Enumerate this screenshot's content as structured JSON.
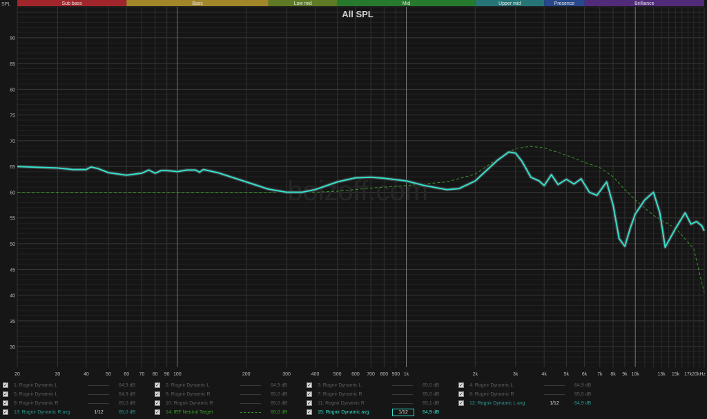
{
  "chart_data": {
    "type": "line",
    "title": "All SPL",
    "ylabel": "SPL",
    "xlabel": "",
    "x_scale": "log",
    "xlim": [
      20,
      20000
    ],
    "ylim": [
      26,
      96
    ],
    "x_ticks": [
      {
        "v": 20,
        "label": "20"
      },
      {
        "v": 30,
        "label": "30"
      },
      {
        "v": 40,
        "label": "40"
      },
      {
        "v": 50,
        "label": "50"
      },
      {
        "v": 60,
        "label": "60"
      },
      {
        "v": 70,
        "label": "70"
      },
      {
        "v": 80,
        "label": "80"
      },
      {
        "v": 90,
        "label": "90"
      },
      {
        "v": 100,
        "label": "100"
      },
      {
        "v": 200,
        "label": "200"
      },
      {
        "v": 300,
        "label": "300"
      },
      {
        "v": 400,
        "label": "400"
      },
      {
        "v": 500,
        "label": "500"
      },
      {
        "v": 600,
        "label": "600"
      },
      {
        "v": 700,
        "label": "700"
      },
      {
        "v": 800,
        "label": "800"
      },
      {
        "v": 900,
        "label": "900"
      },
      {
        "v": 1000,
        "label": "1k"
      },
      {
        "v": 2000,
        "label": "2k"
      },
      {
        "v": 3000,
        "label": "3k"
      },
      {
        "v": 4000,
        "label": "4k"
      },
      {
        "v": 5000,
        "label": "5k"
      },
      {
        "v": 6000,
        "label": "6k"
      },
      {
        "v": 7000,
        "label": "7k"
      },
      {
        "v": 8000,
        "label": "8k"
      },
      {
        "v": 9000,
        "label": "9k"
      },
      {
        "v": 10000,
        "label": "10k"
      },
      {
        "v": 13000,
        "label": "13k"
      },
      {
        "v": 15000,
        "label": "15k"
      },
      {
        "v": 17000,
        "label": "17k"
      },
      {
        "v": 20000,
        "label": "20kHz"
      }
    ],
    "y_ticks": [
      30,
      35,
      40,
      45,
      50,
      55,
      60,
      65,
      70,
      75,
      80,
      85,
      90
    ],
    "bands": [
      {
        "label": "Sub bass",
        "from": 20,
        "to": 60,
        "color": "#a1262c"
      },
      {
        "label": "Bass",
        "from": 60,
        "to": 250,
        "color": "#a2862a"
      },
      {
        "label": "Low mid",
        "from": 250,
        "to": 500,
        "color": "#5f7a25"
      },
      {
        "label": "Mid",
        "from": 500,
        "to": 2000,
        "color": "#27792e"
      },
      {
        "label": "Upper mid",
        "from": 2000,
        "to": 4000,
        "color": "#267475"
      },
      {
        "label": "Presence",
        "from": 4000,
        "to": 6000,
        "color": "#27488a"
      },
      {
        "label": "Brilliance",
        "from": 6000,
        "to": 20000,
        "color": "#512a7a"
      }
    ],
    "watermark": "boizoff.com",
    "grid": true,
    "series": [
      {
        "name": "15: Rognir Dynamic avg",
        "color": "#33e0cc",
        "style": "solid",
        "x": [
          20,
          30,
          35,
          40,
          42,
          45,
          50,
          60,
          70,
          75,
          80,
          85,
          90,
          100,
          110,
          120,
          125,
          130,
          150,
          200,
          250,
          300,
          350,
          400,
          500,
          600,
          700,
          800,
          1000,
          1200,
          1500,
          1700,
          2000,
          2500,
          2800,
          3000,
          3200,
          3500,
          3800,
          4000,
          4300,
          4600,
          5000,
          5400,
          5800,
          6300,
          6800,
          7500,
          8000,
          8500,
          9000,
          9500,
          10000,
          11000,
          12000,
          12800,
          13500,
          15000,
          16500,
          17500,
          18500,
          19500,
          20000
        ],
        "y": [
          65.0,
          64.7,
          64.4,
          64.4,
          64.9,
          64.6,
          63.8,
          63.3,
          63.7,
          64.3,
          63.7,
          64.2,
          64.2,
          64.0,
          64.3,
          64.3,
          63.9,
          64.4,
          63.8,
          62.0,
          60.6,
          60.0,
          60.0,
          60.5,
          62.0,
          62.8,
          62.9,
          62.7,
          62.2,
          61.3,
          60.5,
          60.7,
          62.2,
          66.2,
          67.8,
          67.6,
          66.0,
          62.9,
          62.2,
          61.3,
          63.4,
          61.5,
          62.5,
          61.6,
          62.6,
          60.0,
          59.4,
          62.0,
          57.5,
          51.0,
          49.5,
          53.0,
          55.8,
          58.5,
          60.0,
          56.0,
          49.3,
          53.0,
          56.0,
          53.8,
          54.3,
          53.5,
          52.5
        ]
      },
      {
        "name": "14: IEF Neutral Target",
        "color": "#3a9a2a",
        "style": "dashed",
        "x": [
          20,
          100,
          200,
          300,
          400,
          500,
          700,
          1000,
          1500,
          2000,
          2500,
          3000,
          3500,
          4000,
          5000,
          6000,
          7000,
          8000,
          9000,
          10000,
          12000,
          15000,
          18000,
          20000
        ],
        "y": [
          60,
          60,
          60,
          60,
          60,
          60.2,
          60.8,
          61.3,
          62.0,
          63.5,
          66.5,
          68.5,
          68.9,
          68.6,
          67.2,
          65.8,
          64.8,
          63.0,
          60.5,
          58.5,
          55.5,
          53.0,
          49.0,
          40.5
        ]
      }
    ]
  },
  "legend": [
    {
      "name": "1: Rognir Dynamic L",
      "value": "64,9 dB",
      "active": false
    },
    {
      "name": "2: Rognir Dynamic L",
      "value": "64,9 dB",
      "active": false
    },
    {
      "name": "3: Rognir Dynamic L",
      "value": "65,0 dB",
      "active": false
    },
    {
      "name": "4: Rognir Dynamic L",
      "value": "64,9 dB",
      "active": false
    },
    {
      "name": "5: Rognir Dynamic L",
      "value": "64,9 dB",
      "active": false
    },
    {
      "name": "6: Rognir Dynamic R",
      "value": "65,0 dB",
      "active": false
    },
    {
      "name": "7: Rognir Dynamic R",
      "value": "65,0 dB",
      "active": false
    },
    {
      "name": "8: Rognir Dynamic R",
      "value": "65,0 dB",
      "active": false
    },
    {
      "name": "9: Rognir Dynamic R",
      "value": "65,0 dB",
      "active": false
    },
    {
      "name": "10: Rognir Dynamic R",
      "value": "65,0 dB",
      "active": false
    },
    {
      "name": "11: Rognir Dynamic R",
      "value": "65,1 dB",
      "active": false
    },
    {
      "name": "12: Rognir Dynamic L avg",
      "value": "64,9 dB",
      "active": true,
      "smoothing": "1/12",
      "color": "#2a9a92"
    },
    {
      "name": "13: Rognir Dynamic R avg",
      "value": "65,0 dB",
      "active": true,
      "smoothing": "1/12",
      "color": "#2a9a92"
    },
    {
      "name": "14: IEF Neutral Target",
      "value": "60,0 dB",
      "active": true,
      "color": "#3a9a2a"
    },
    {
      "name": "15: Rognir Dynamic avg",
      "value": "64,9 dB",
      "active": true,
      "smoothing": "1/12",
      "color": "#33e0cc"
    }
  ]
}
